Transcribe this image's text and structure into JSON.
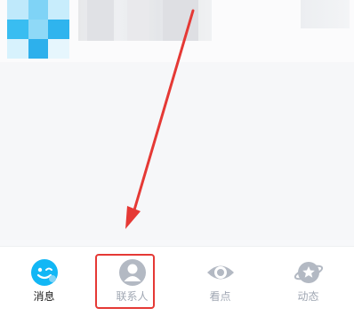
{
  "tabs": [
    {
      "label": "消息",
      "icon": "chat-smile-icon",
      "active": true
    },
    {
      "label": "联系人",
      "icon": "contact-person-icon",
      "active": false
    },
    {
      "label": "看点",
      "icon": "eye-icon",
      "active": false
    },
    {
      "label": "动态",
      "icon": "star-planet-icon",
      "active": false
    }
  ],
  "colors": {
    "accent": "#12b7f5",
    "inactive": "#a0a7b3",
    "annotation": "#e53935"
  }
}
